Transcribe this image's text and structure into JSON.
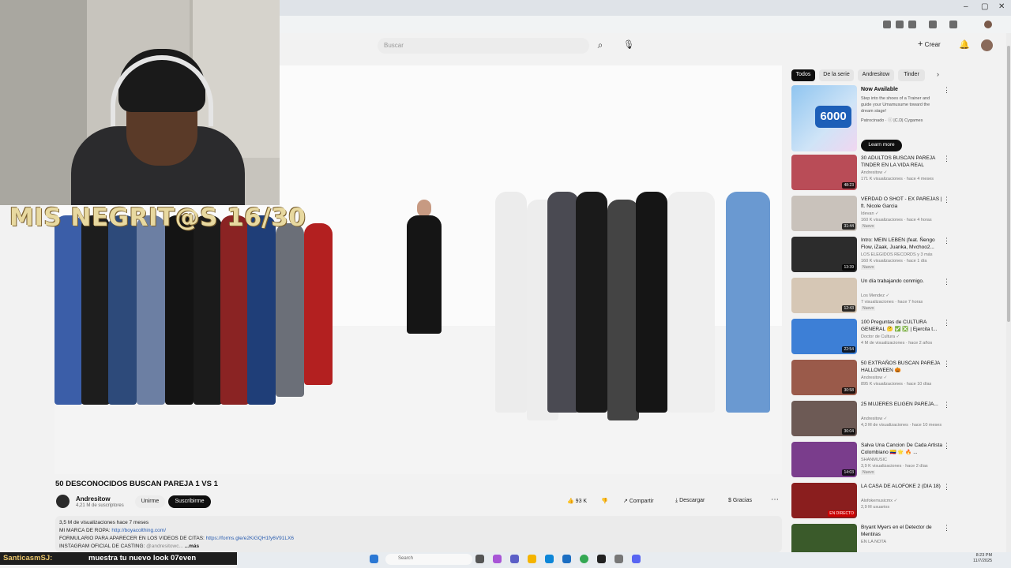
{
  "browser": {
    "minimize": "–",
    "maximize": "▢",
    "close": "✕"
  },
  "header": {
    "search_placeholder": "Buscar",
    "create_label": "Crear",
    "plus": "+"
  },
  "stream_overlay": {
    "progress_text": "MIS NEGRIT@S 16/30"
  },
  "video": {
    "title": "50 DESCONOCIDOS BUSCAN PAREJA 1 VS 1",
    "channel": "Andresitow",
    "subscribers": "4,21 M de suscriptores",
    "join_label": "Unirme",
    "subscribe_label": "Suscribirme",
    "likes": "93 K",
    "share_label": "Compartir",
    "download_label": "Descargar",
    "thanks_label": "Gracias",
    "more": "⋯"
  },
  "description": {
    "stats": "3,5 M de visualizaciones  hace 7 meses",
    "line1_text": "MI MARCA DE ROPA: ",
    "line1_link": "http://boyacolthing.com/",
    "line2_text": "FORMULARIO PARA APARECER EN LOS VIDEOS DE CITAS: ",
    "line2_link": "https://forms.gle/e2KiGQH1fy6V91LX6",
    "line3_text": "INSTAGRAM OFICIAL DE CASTING:",
    "line3_handle": " @andresitowc... ",
    "more": "...más"
  },
  "chips": [
    "Todos",
    "De la serie",
    "Andresitow",
    "Tinder"
  ],
  "chip_next": "›",
  "ad": {
    "title": "Now Available",
    "desc": "Step into the shoes of a Trainer and guide your Umamusume toward the dream stage!",
    "sponsor": "Patrocinado · ⓘ |C.D| Cygames",
    "badge": "6000",
    "cta": "Learn more"
  },
  "recommendations": [
    {
      "title": "30 ADULTOS BUSCAN PAREJA TINDER EN LA VIDA REAL",
      "channel": "Andresitow ✓",
      "meta": "171 K visualizaciones · hace 4 meses",
      "badge": "48:23",
      "tag": "",
      "color": "#b94c57"
    },
    {
      "title": "VERDAD O SHOT - EX PAREJAS | ft. Nicole Garcia",
      "channel": "Idevan ✓",
      "meta": "160 K visualizaciones · hace 4 horas",
      "badge": "31:44",
      "tag": "Nuevo",
      "color": "#c9c2bb"
    },
    {
      "title": "Intro: MEIN LEBEN (feat. Ñengo Flow, iZaak, Juanka, Mvchoo2...",
      "channel": "LOS ELEGIDOS RECORDS y 3 más",
      "meta": "160 K visualizaciones · hace 1 día",
      "badge": "13:39",
      "tag": "Nuevo",
      "color": "#2c2c2c"
    },
    {
      "title": "Un día trabajando conmigo.",
      "channel": "Los Mendez ✓",
      "meta": "7 visualizaciones · hace 7 horas",
      "badge": "12:43",
      "tag": "Nuevo",
      "color": "#d6c7b5"
    },
    {
      "title": "100 Preguntas de CULTURA GENERAL 🤔 ✅ ❎ | Ejercita t...",
      "channel": "Doctor de Cultura ✓",
      "meta": "4 M de visualizaciones · hace 2 años",
      "badge": "22:54",
      "tag": "",
      "color": "#3d7fd6"
    },
    {
      "title": "50 EXTRAÑOS BUSCAN PAREJA HALLOWEEN 🎃",
      "channel": "Andresitow ✓",
      "meta": "895 K visualizaciones · hace 10 días",
      "badge": "30:58",
      "tag": "",
      "color": "#9a5a4a"
    },
    {
      "title": "25 MUJERES ELIGEN PAREJA...",
      "channel": "Andresitow ✓",
      "meta": "4,3 M de visualizaciones · hace 10 meses",
      "badge": "36:04",
      "tag": "",
      "color": "#6d5a55"
    },
    {
      "title": "Salva Una Cancion De Cada Artista Colombiano 🇨🇴 🌟 🔥 ...",
      "channel": "SHANMUSIC",
      "meta": "3,9 K visualizaciones · hace 2 días",
      "badge": "14:03",
      "tag": "Nuevo",
      "color": "#7a3d8c"
    },
    {
      "title": "LA CASA DE ALOFOKE 2 (DIA 18)",
      "channel": "Alofokemusicmx ✓",
      "meta": "2,9 M usuarios",
      "badge": "EN DIRECTO",
      "tag": "",
      "color": "#8a1e1e"
    },
    {
      "title": "Bryant Myers en el Detector de Mentiras",
      "channel": "EN LA NOTA",
      "meta": "",
      "badge": "",
      "tag": "",
      "color": "#3a5a2a"
    }
  ],
  "chat": {
    "user": "SanticasmSJ:",
    "message": "muestra tu nuevo look 07even"
  },
  "taskbar": {
    "search": "Search",
    "time": "8:23 PM",
    "date": "11/7/2025"
  }
}
